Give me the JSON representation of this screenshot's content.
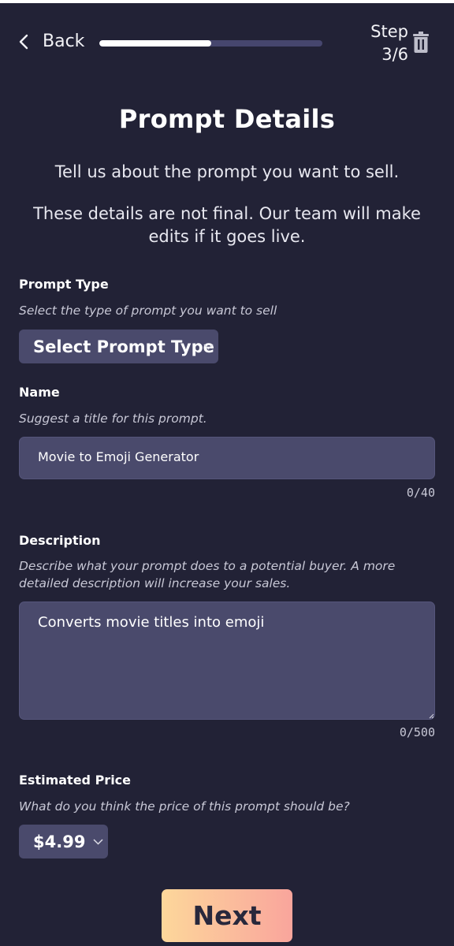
{
  "header": {
    "back_label": "Back",
    "progress_fraction": 0.5,
    "step_label": "Step",
    "step_value": "3/6"
  },
  "title": "Prompt Details",
  "intro_line1": "Tell us about the prompt you want to sell.",
  "intro_line2": "These details are not final. Our team will make edits if it goes live.",
  "prompt_type": {
    "label": "Prompt Type",
    "hint": "Select the type of prompt you want to sell",
    "selected": "Select Prompt Type"
  },
  "name": {
    "label": "Name",
    "hint": "Suggest a title for this prompt.",
    "value": "Movie to Emoji Generator",
    "counter": "0/40"
  },
  "description": {
    "label": "Description",
    "hint": "Describe what your prompt does to a potential buyer. A more detailed description will increase your sales.",
    "value": "Converts movie titles into emoji",
    "counter": "0/500"
  },
  "price": {
    "label": "Estimated Price",
    "hint": "What do you think the price of this prompt should be?",
    "selected": "$4.99"
  },
  "next_label": "Next",
  "colors": {
    "background": "#222236",
    "field": "#4a4a6c",
    "progress_track": "#46466e",
    "button_gradient_start": "#fdd79b",
    "button_gradient_end": "#f9a59c"
  }
}
